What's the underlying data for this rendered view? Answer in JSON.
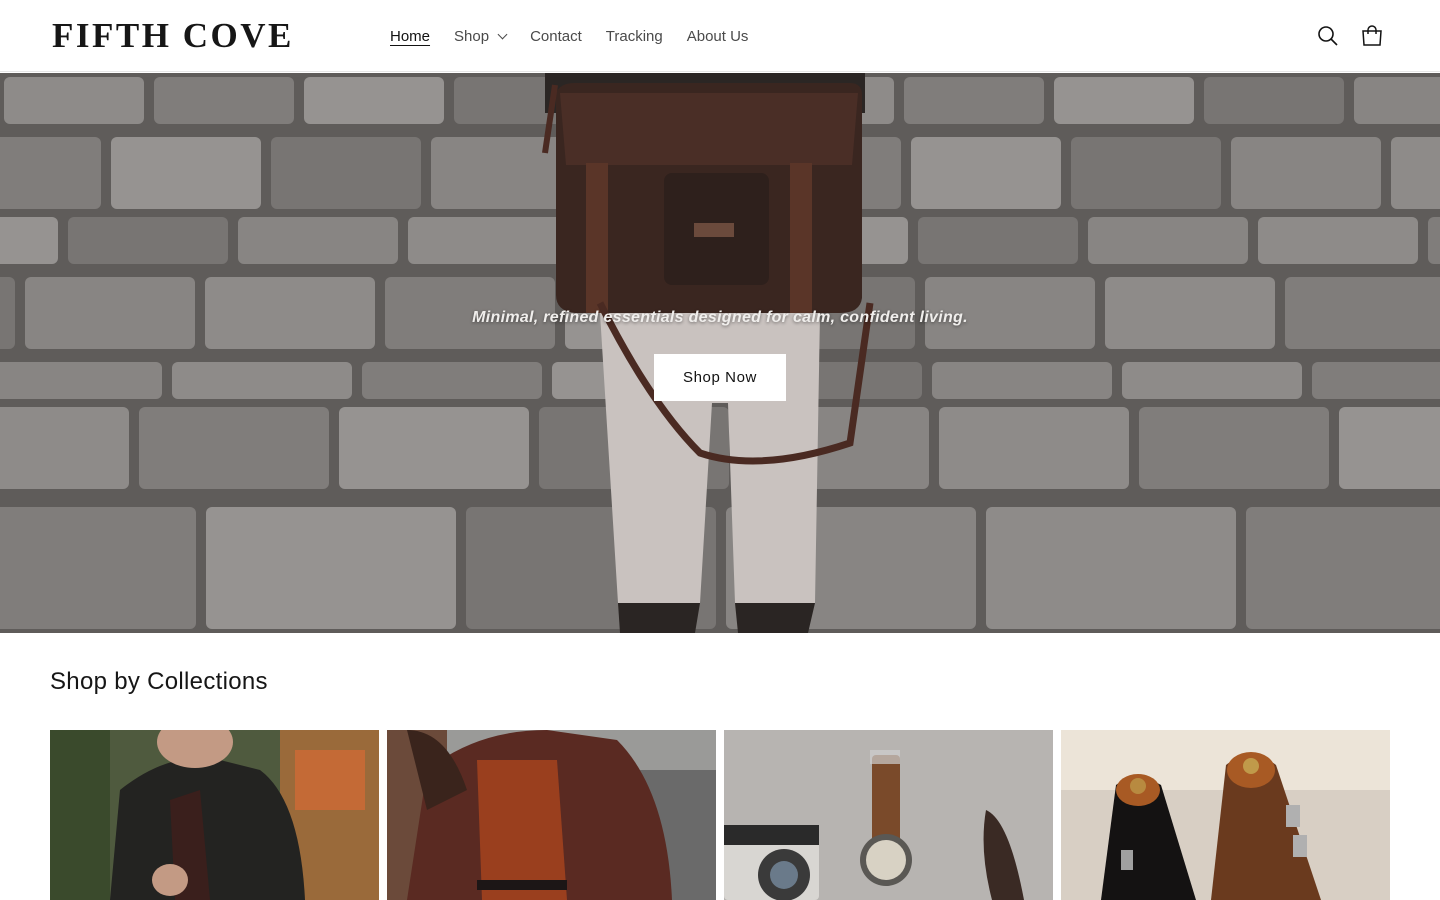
{
  "brand": {
    "logo_text": "FIFTH COVE"
  },
  "nav": {
    "items": [
      {
        "label": "Home",
        "active": true
      },
      {
        "label": "Shop",
        "has_dropdown": true
      },
      {
        "label": "Contact"
      },
      {
        "label": "Tracking"
      },
      {
        "label": "About Us"
      }
    ]
  },
  "header_icons": {
    "search": "search-icon",
    "cart": "cart-icon"
  },
  "hero": {
    "tagline": "Minimal, refined essentials designed for calm, confident living.",
    "cta_label": "Shop Now"
  },
  "collections": {
    "title": "Shop by Collections",
    "tiles": [
      {
        "image": "man-in-dark-jacket-photo"
      },
      {
        "image": "woman-in-brown-coat-photo"
      },
      {
        "image": "camera-watch-sunglasses-photo"
      },
      {
        "image": "leather-monk-shoes-photo"
      }
    ]
  },
  "colors": {
    "text": "#121212",
    "muted": "#4a4a4a",
    "button_bg": "#ffffff"
  }
}
